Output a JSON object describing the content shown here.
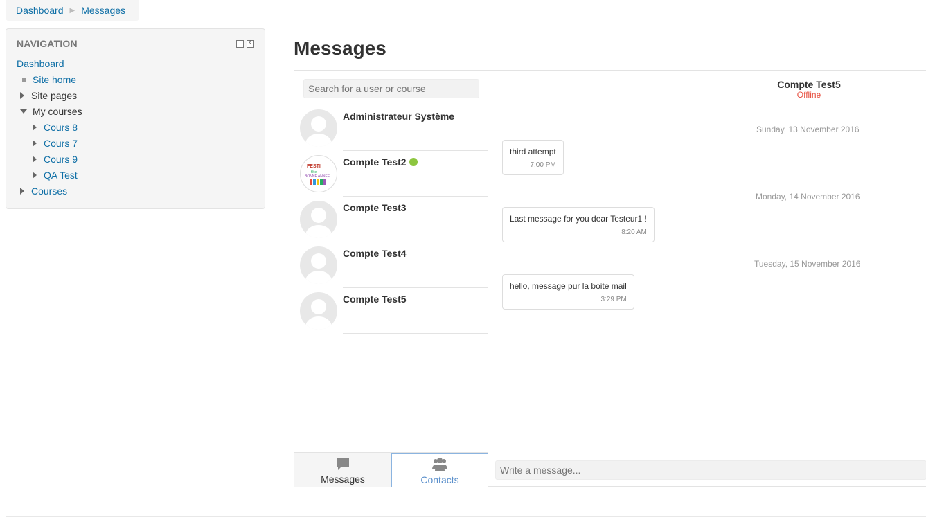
{
  "breadcrumb": {
    "items": [
      "Dashboard",
      "Messages"
    ]
  },
  "navigation": {
    "title": "NAVIGATION",
    "dashboard": "Dashboard",
    "site_home": "Site home",
    "site_pages": "Site pages",
    "my_courses": "My courses",
    "courses_list": [
      "Cours 8",
      "Cours 7",
      "Cours 9",
      "QA Test"
    ],
    "courses": "Courses"
  },
  "page": {
    "title": "Messages"
  },
  "search": {
    "placeholder": "Search for a user or course"
  },
  "contacts": [
    {
      "name": "Administrateur Système",
      "online": false,
      "avatar": "default-user-icon"
    },
    {
      "name": "Compte Test2",
      "online": true,
      "avatar": "custom-picture"
    },
    {
      "name": "Compte Test3",
      "online": false,
      "avatar": "default-user-icon"
    },
    {
      "name": "Compte Test4",
      "online": false,
      "avatar": "default-user-icon"
    },
    {
      "name": "Compte Test5",
      "online": false,
      "avatar": "default-user-icon"
    }
  ],
  "tabs": {
    "messages": "Messages",
    "contacts": "Contacts"
  },
  "conversation": {
    "name": "Compte Test5",
    "status": "Offline",
    "status_color": "#e74c3c",
    "days": [
      "Sunday, 13 November 2016",
      "Monday, 14 November 2016",
      "Tuesday, 15 November 2016"
    ],
    "messages": [
      {
        "text": "third attempt",
        "time": "7:00 PM"
      },
      {
        "text": "Last message for you dear Testeur1 !",
        "time": "8:20 AM"
      },
      {
        "text": "hello, message pur la boite mail",
        "time": "3:29 PM"
      }
    ]
  },
  "compose": {
    "placeholder": "Write a message..."
  },
  "colors": {
    "link": "#0f6fa6",
    "online": "#8dc63f",
    "active_tab": "#5a8fcb"
  }
}
